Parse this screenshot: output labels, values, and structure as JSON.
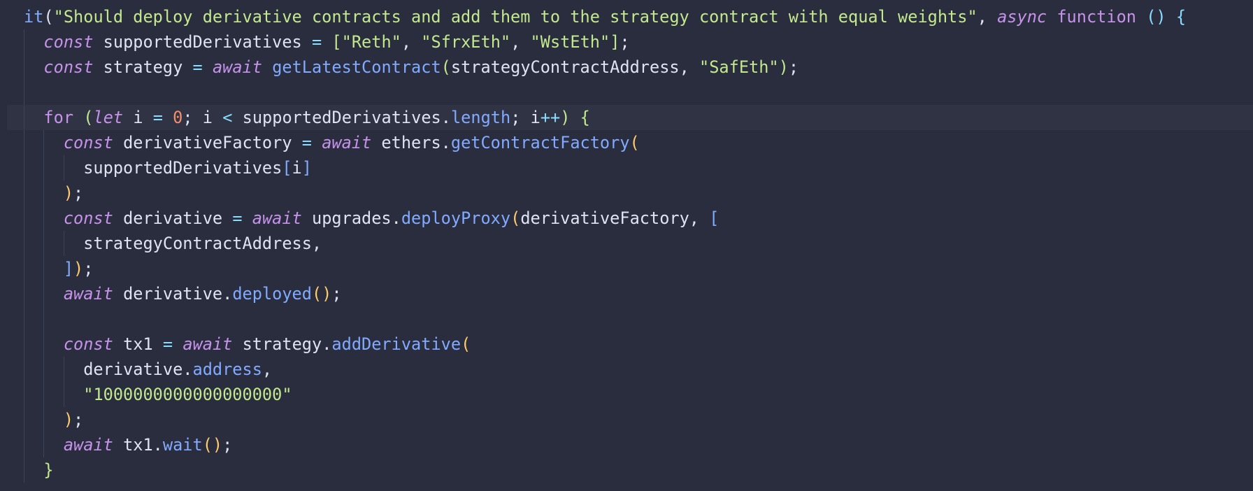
{
  "editor": {
    "theme": {
      "background": "#292d3e",
      "active_line": "#2f3344",
      "text": "#dfe3f2",
      "string": "#c3e88d",
      "keyword": "#c792ea",
      "function": "#82aaff",
      "operator": "#89ddff",
      "number": "#f78c6c",
      "paren": "#ffcb6b"
    },
    "lines": [
      [
        {
          "t": "it",
          "c": "t-fn"
        },
        {
          "t": "(",
          "c": "t-plain"
        },
        {
          "t": "\"Should deploy derivative contracts and add them to the strategy contract with equal weights\"",
          "c": "t-str"
        },
        {
          "t": ", ",
          "c": "t-plain"
        },
        {
          "t": "async",
          "c": "t-kw-it"
        },
        {
          "t": " ",
          "c": "t-plain"
        },
        {
          "t": "function",
          "c": "t-kw"
        },
        {
          "t": " ",
          "c": "t-plain"
        },
        {
          "t": "()",
          "c": "t-brace2"
        },
        {
          "t": " ",
          "c": "t-plain"
        },
        {
          "t": "{",
          "c": "t-brace2"
        }
      ],
      [
        {
          "t": "  ",
          "c": "t-plain"
        },
        {
          "t": "const",
          "c": "t-kw-it"
        },
        {
          "t": " supportedDerivatives ",
          "c": "t-plain"
        },
        {
          "t": "=",
          "c": "t-op"
        },
        {
          "t": " ",
          "c": "t-plain"
        },
        {
          "t": "[",
          "c": "t-brace1"
        },
        {
          "t": "\"Reth\"",
          "c": "t-str"
        },
        {
          "t": ", ",
          "c": "t-plain"
        },
        {
          "t": "\"SfrxEth\"",
          "c": "t-str"
        },
        {
          "t": ", ",
          "c": "t-plain"
        },
        {
          "t": "\"WstEth\"",
          "c": "t-str"
        },
        {
          "t": "]",
          "c": "t-brace1"
        },
        {
          "t": ";",
          "c": "t-plain"
        }
      ],
      [
        {
          "t": "  ",
          "c": "t-plain"
        },
        {
          "t": "const",
          "c": "t-kw-it"
        },
        {
          "t": " strategy ",
          "c": "t-plain"
        },
        {
          "t": "=",
          "c": "t-op"
        },
        {
          "t": " ",
          "c": "t-plain"
        },
        {
          "t": "await",
          "c": "t-kw-it"
        },
        {
          "t": " ",
          "c": "t-plain"
        },
        {
          "t": "getLatestContract",
          "c": "t-call"
        },
        {
          "t": "(",
          "c": "t-brace1"
        },
        {
          "t": "strategyContractAddress, ",
          "c": "t-plain"
        },
        {
          "t": "\"SafEth\"",
          "c": "t-str"
        },
        {
          "t": ")",
          "c": "t-brace1"
        },
        {
          "t": ";",
          "c": "t-plain"
        }
      ],
      [],
      [
        {
          "t": "  ",
          "c": "t-plain"
        },
        {
          "t": "for",
          "c": "t-kw"
        },
        {
          "t": " ",
          "c": "t-plain"
        },
        {
          "t": "(",
          "c": "t-brace1"
        },
        {
          "t": "let",
          "c": "t-kw-it"
        },
        {
          "t": " i ",
          "c": "t-plain"
        },
        {
          "t": "=",
          "c": "t-op"
        },
        {
          "t": " ",
          "c": "t-plain"
        },
        {
          "t": "0",
          "c": "t-num"
        },
        {
          "t": "; i ",
          "c": "t-plain"
        },
        {
          "t": "<",
          "c": "t-op"
        },
        {
          "t": " supportedDerivatives.",
          "c": "t-plain"
        },
        {
          "t": "length",
          "c": "t-prop"
        },
        {
          "t": "; i",
          "c": "t-plain"
        },
        {
          "t": "++",
          "c": "t-op"
        },
        {
          "t": ")",
          "c": "t-brace1"
        },
        {
          "t": " ",
          "c": "t-plain"
        },
        {
          "t": "{",
          "c": "t-brace1"
        }
      ],
      [
        {
          "t": "    ",
          "c": "t-plain"
        },
        {
          "t": "const",
          "c": "t-kw-it"
        },
        {
          "t": " derivativeFactory ",
          "c": "t-plain"
        },
        {
          "t": "=",
          "c": "t-op"
        },
        {
          "t": " ",
          "c": "t-plain"
        },
        {
          "t": "await",
          "c": "t-kw-it"
        },
        {
          "t": " ethers.",
          "c": "t-plain"
        },
        {
          "t": "getContractFactory",
          "c": "t-call"
        },
        {
          "t": "(",
          "c": "t-paren"
        }
      ],
      [
        {
          "t": "      supportedDerivatives",
          "c": "t-plain"
        },
        {
          "t": "[",
          "c": "t-bracket"
        },
        {
          "t": "i",
          "c": "t-plain"
        },
        {
          "t": "]",
          "c": "t-bracket"
        }
      ],
      [
        {
          "t": "    ",
          "c": "t-plain"
        },
        {
          "t": ")",
          "c": "t-paren"
        },
        {
          "t": ";",
          "c": "t-plain"
        }
      ],
      [
        {
          "t": "    ",
          "c": "t-plain"
        },
        {
          "t": "const",
          "c": "t-kw-it"
        },
        {
          "t": " derivative ",
          "c": "t-plain"
        },
        {
          "t": "=",
          "c": "t-op"
        },
        {
          "t": " ",
          "c": "t-plain"
        },
        {
          "t": "await",
          "c": "t-kw-it"
        },
        {
          "t": " upgrades.",
          "c": "t-plain"
        },
        {
          "t": "deployProxy",
          "c": "t-call"
        },
        {
          "t": "(",
          "c": "t-paren"
        },
        {
          "t": "derivativeFactory, ",
          "c": "t-plain"
        },
        {
          "t": "[",
          "c": "t-bracket"
        }
      ],
      [
        {
          "t": "      strategyContractAddress,",
          "c": "t-plain"
        }
      ],
      [
        {
          "t": "    ",
          "c": "t-plain"
        },
        {
          "t": "]",
          "c": "t-bracket"
        },
        {
          "t": ")",
          "c": "t-paren"
        },
        {
          "t": ";",
          "c": "t-plain"
        }
      ],
      [
        {
          "t": "    ",
          "c": "t-plain"
        },
        {
          "t": "await",
          "c": "t-kw-it"
        },
        {
          "t": " derivative.",
          "c": "t-plain"
        },
        {
          "t": "deployed",
          "c": "t-call"
        },
        {
          "t": "()",
          "c": "t-paren"
        },
        {
          "t": ";",
          "c": "t-plain"
        }
      ],
      [],
      [
        {
          "t": "    ",
          "c": "t-plain"
        },
        {
          "t": "const",
          "c": "t-kw-it"
        },
        {
          "t": " tx1 ",
          "c": "t-plain"
        },
        {
          "t": "=",
          "c": "t-op"
        },
        {
          "t": " ",
          "c": "t-plain"
        },
        {
          "t": "await",
          "c": "t-kw-it"
        },
        {
          "t": " strategy.",
          "c": "t-plain"
        },
        {
          "t": "addDerivative",
          "c": "t-call"
        },
        {
          "t": "(",
          "c": "t-paren"
        }
      ],
      [
        {
          "t": "      derivative.",
          "c": "t-plain"
        },
        {
          "t": "address",
          "c": "t-prop"
        },
        {
          "t": ",",
          "c": "t-plain"
        }
      ],
      [
        {
          "t": "      ",
          "c": "t-plain"
        },
        {
          "t": "\"1000000000000000000\"",
          "c": "t-str"
        }
      ],
      [
        {
          "t": "    ",
          "c": "t-plain"
        },
        {
          "t": ")",
          "c": "t-paren"
        },
        {
          "t": ";",
          "c": "t-plain"
        }
      ],
      [
        {
          "t": "    ",
          "c": "t-plain"
        },
        {
          "t": "await",
          "c": "t-kw-it"
        },
        {
          "t": " tx1.",
          "c": "t-plain"
        },
        {
          "t": "wait",
          "c": "t-call"
        },
        {
          "t": "()",
          "c": "t-paren"
        },
        {
          "t": ";",
          "c": "t-plain"
        }
      ],
      [
        {
          "t": "  ",
          "c": "t-plain"
        },
        {
          "t": "}",
          "c": "t-brace1"
        }
      ]
    ]
  }
}
